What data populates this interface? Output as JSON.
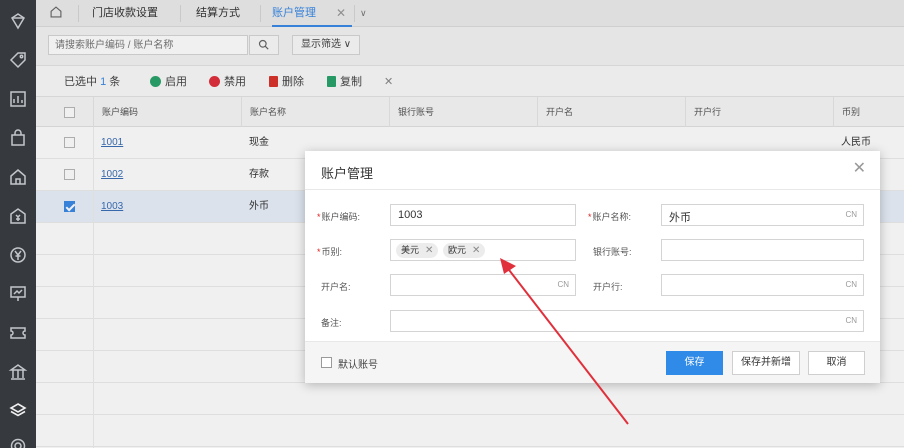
{
  "tabs": {
    "home_icon": "home-icon",
    "items": [
      {
        "label": "门店收款设置"
      },
      {
        "label": "结算方式"
      },
      {
        "label": "账户管理"
      }
    ],
    "close_glyph": "✕",
    "caret_glyph": "∨"
  },
  "search": {
    "placeholder": "请搜索账户编码 / 账户名称",
    "filter_label": "显示筛选 ∨"
  },
  "toolbar": {
    "selected_prefix": "已选中",
    "selected_count": "1",
    "selected_suffix": "条",
    "enable": "启用",
    "disable": "禁用",
    "delete": "删除",
    "copy": "复制",
    "close": "✕"
  },
  "table": {
    "headers": [
      "账户编码",
      "账户名称",
      "银行账号",
      "开户名",
      "开户行",
      "币别"
    ],
    "rows": [
      {
        "code": "1001",
        "name": "现金",
        "currency": "人民币",
        "checked": false
      },
      {
        "code": "1002",
        "name": "存款",
        "currency": "",
        "checked": false
      },
      {
        "code": "1003",
        "name": "外币",
        "currency": "",
        "checked": true
      }
    ]
  },
  "modal": {
    "title": "账户管理",
    "close": "✕",
    "fields": {
      "code_label": "账户编码:",
      "code_value": "1003",
      "name_label": "账户名称:",
      "name_value": "外币",
      "currency_label": "币别:",
      "currency_chips": [
        "美元",
        "欧元"
      ],
      "bank_account_label": "银行账号:",
      "account_holder_label": "开户名:",
      "bank_label": "开户行:",
      "remark_label": "备注:",
      "cn_tag": "CN",
      "required_mark": "*"
    },
    "footer": {
      "default_account": "默认账号",
      "save": "保存",
      "save_new": "保存并新增",
      "cancel": "取消"
    }
  },
  "colors": {
    "primary": "#2f8ae8",
    "enable_dot": "#2aa36b",
    "disable_dot": "#e0303c",
    "delete_icon": "#d9342b",
    "copy_icon": "#2aa36b",
    "arrow": "#e0303c"
  }
}
